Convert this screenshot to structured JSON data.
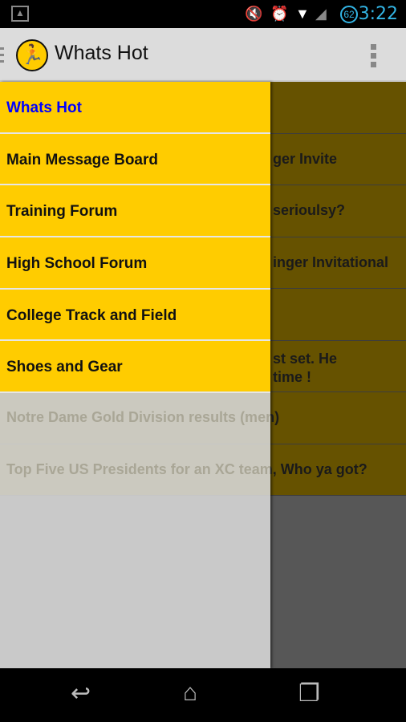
{
  "status_bar": {
    "time": "3:22",
    "battery": "62"
  },
  "action_bar": {
    "title": "Whats Hot"
  },
  "drawer": {
    "items": [
      {
        "label": "Whats Hot",
        "active": true
      },
      {
        "label": "Main Message Board"
      },
      {
        "label": "Training Forum"
      },
      {
        "label": "High School Forum"
      },
      {
        "label": "College Track and Field"
      },
      {
        "label": "Shoes and Gear"
      }
    ]
  },
  "list": {
    "rows": [
      {
        "text": ""
      },
      {
        "text": "ger Invite"
      },
      {
        "text": "serioulsy?"
      },
      {
        "text": "inger Invitational"
      },
      {
        "text": ""
      },
      {
        "text": "st set. He",
        "text2": "time !"
      },
      {
        "text": "Notre Dame Gold Division results (men)"
      },
      {
        "text": "Top Five US Presidents for an XC team, Who ya got?"
      }
    ]
  },
  "colors": {
    "accent": "#ffcc00",
    "active_text": "#0000ff",
    "status": "#33b5e5"
  }
}
